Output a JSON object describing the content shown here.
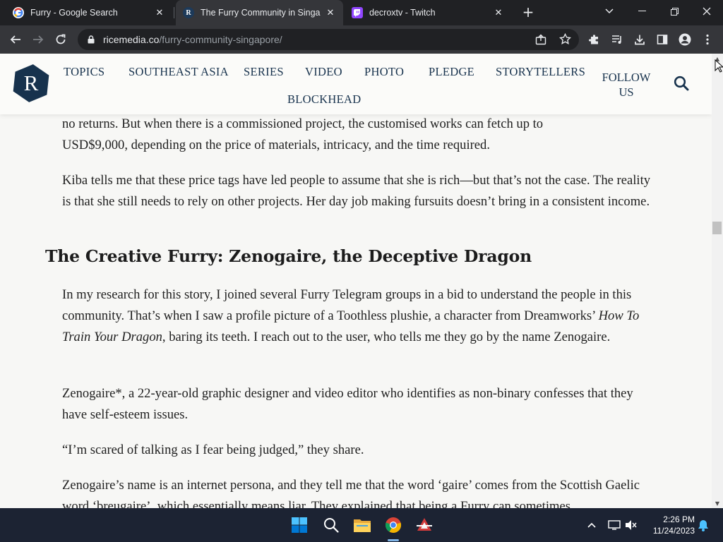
{
  "browser": {
    "tabs": [
      {
        "title": "Furry - Google Search",
        "favicon": "google-icon"
      },
      {
        "title": "The Furry Community in Singapo",
        "favicon": "ricemedia-icon"
      },
      {
        "title": "decroxtv - Twitch",
        "favicon": "twitch-icon"
      }
    ],
    "url_domain": "ricemedia.co",
    "url_path": "/furry-community-singapore/"
  },
  "site": {
    "logo_letter": "R",
    "nav": [
      "TOPICS",
      "SOUTHEAST ASIA",
      "SERIES",
      "VIDEO",
      "PHOTO",
      "PLEDGE",
      "STORYTELLERS",
      "BLOCKHEAD"
    ],
    "follow_line1": "FOLLOW",
    "follow_line2": "US"
  },
  "article": {
    "p1_line1": "no returns. But when there is a commissioned project, the customised works can fetch up to",
    "p1_line2": "USD$9,000, depending on the price of materials, intricacy, and the time required.",
    "p2": "Kiba tells me that these price tags have led people to assume that she is rich—but that’s not the case. The reality is that she still needs to rely on other projects. Her day job making fursuits doesn’t bring in a consistent income.",
    "heading": "The Creative Furry: Zenogaire, the Deceptive Dragon",
    "p3_before": "In my research for this story, I joined several Furry Telegram groups in a bid to understand the people in this community. That’s when I saw a profile picture of a Toothless plushie, a character from Dreamworks’ ",
    "p3_italic": "How To Train Your Dragon",
    "p3_after": ", baring its teeth. I reach out to the user, who tells me they go by the name Zenogaire.",
    "p4": "Zenogaire*, a 22-year-old graphic designer and video editor who identifies as non-binary confesses that they have self-esteem issues.",
    "p5": "“I’m scared of talking as I fear being judged,” they share.",
    "p6": "Zenogaire’s name is an internet persona, and they tell me that the word ‘gaire’ comes from the Scottish Gaelic word ‘breugaire’, which essentially means liar. They explained that being a Furry can sometimes"
  },
  "taskbar": {
    "time": "2:26 PM",
    "date": "11/24/2023"
  },
  "colors": {
    "brand_navy": "#17324d",
    "chrome_dark": "#202124",
    "chrome_toolbar": "#35363a",
    "taskbar": "#1c2333"
  }
}
